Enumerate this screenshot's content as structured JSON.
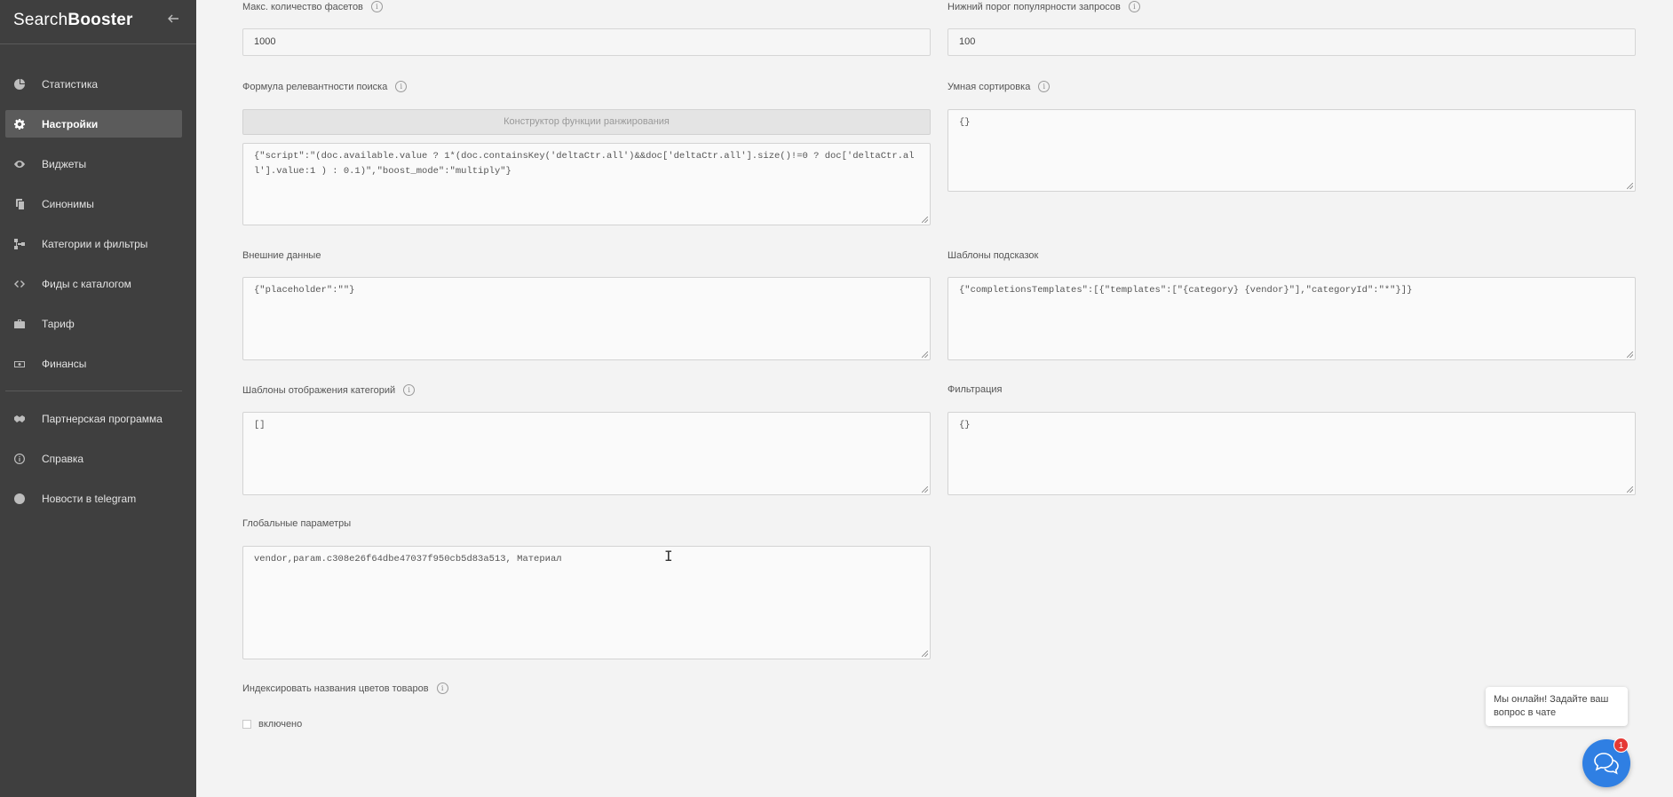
{
  "sidebar": {
    "brand_regular": "Search",
    "brand_bold": "Booster",
    "collapse_icon": "arrow-left-icon",
    "items": [
      {
        "label": "Статистика",
        "icon": "chart-pie-icon"
      },
      {
        "label": "Настройки",
        "icon": "gear-icon"
      },
      {
        "label": "Виджеты",
        "icon": "eye-icon"
      },
      {
        "label": "Синонимы",
        "icon": "copy-icon"
      },
      {
        "label": "Категории и фильтры",
        "icon": "sitemap-icon"
      },
      {
        "label": "Фиды с каталогом",
        "icon": "code-icon"
      },
      {
        "label": "Тариф",
        "icon": "briefcase-icon"
      },
      {
        "label": "Финансы",
        "icon": "money-icon"
      }
    ],
    "items_secondary": [
      {
        "label": "Партнерская программа",
        "icon": "handshake-icon"
      },
      {
        "label": "Справка",
        "icon": "info-circle-icon"
      },
      {
        "label": "Новости в telegram",
        "icon": "telegram-icon"
      }
    ],
    "active_item": "Настройки"
  },
  "settings": {
    "max_facets": {
      "label": "Макс. количество фасетов",
      "value": "1000"
    },
    "min_popularity": {
      "label": "Нижний порог популярности запросов",
      "value": "100"
    },
    "relevance_formula": {
      "label": "Формула релевантности поиска",
      "button": "Конструктор функции ранжирования",
      "value": "{\"script\":\"(doc.available.value ? 1*(doc.containsKey('deltaCtr.all')&&doc['deltaCtr.all'].size()!=0 ? doc['deltaCtr.all'].value:1 ) : 0.1)\",\"boost_mode\":\"multiply\"}"
    },
    "smart_sort": {
      "label": "Умная сортировка",
      "value": "{}"
    },
    "external_data": {
      "label": "Внешние данные",
      "value": "{\"placeholder\":\"\"}"
    },
    "suggest_templates": {
      "label": "Шаблоны подсказок",
      "value": "{\"completionsTemplates\":[{\"templates\":[\"{category} {vendor}\"],\"categoryId\":\"*\"}]}"
    },
    "category_display_templates": {
      "label": "Шаблоны отображения категорий",
      "value": "[]"
    },
    "filtering": {
      "label": "Фильтрация",
      "value": "{}"
    },
    "global_params": {
      "label": "Глобальные параметры",
      "value": "vendor,param.c308e26f64dbe47037f950cb5d83a513, Материал"
    },
    "index_color_names": {
      "label": "Индексировать названия цветов товаров",
      "checkbox_label": "включено",
      "checked": false
    }
  },
  "chat": {
    "message": "Мы онлайн! Задайте ваш вопрос в чате",
    "badge_count": "1",
    "icon": "chat-bubbles-icon"
  },
  "colors": {
    "sidebar_bg": "#3f3f3f",
    "sidebar_active": "#5b5b5b",
    "main_bg": "#f3f3f3",
    "chat_button": "#2f7fe3",
    "badge": "#e53935"
  }
}
